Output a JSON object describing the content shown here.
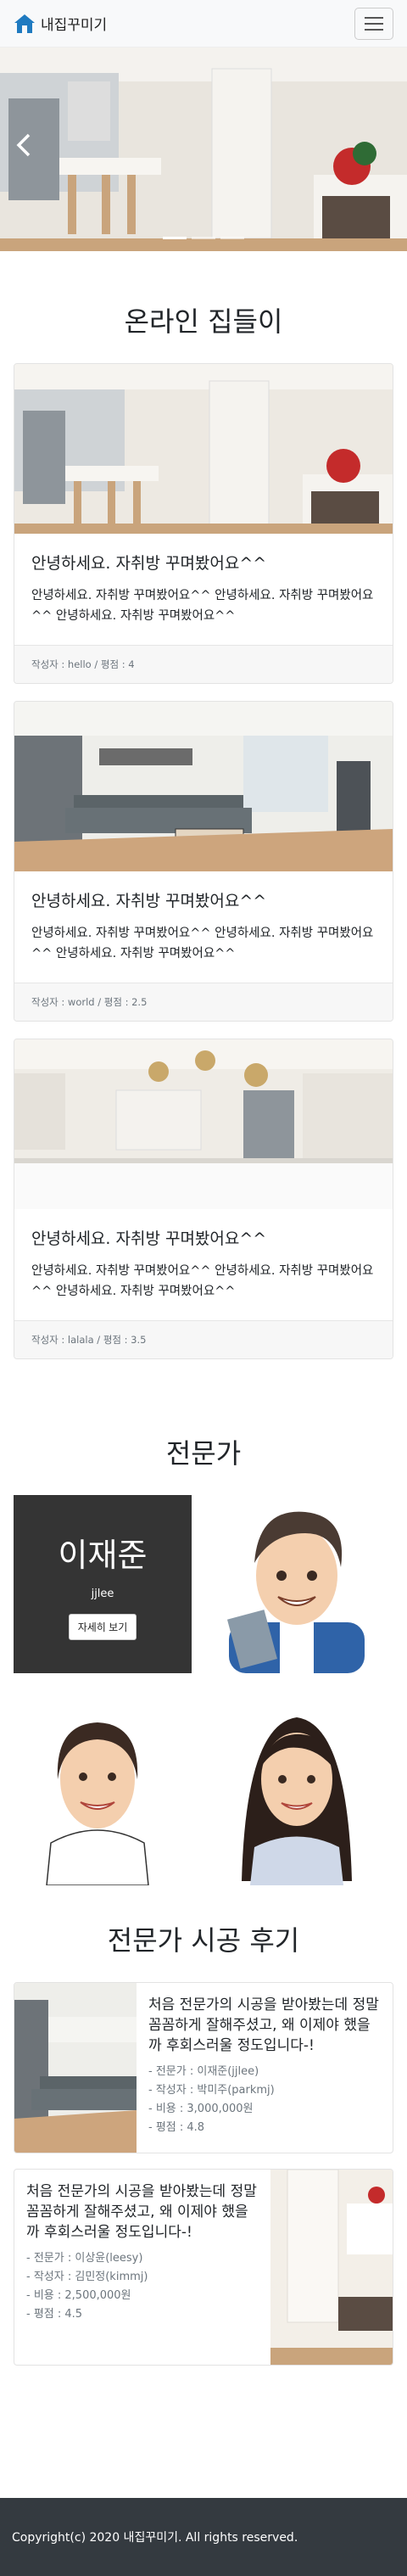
{
  "navbar": {
    "brand": "내집꾸미기"
  },
  "sections": {
    "online": "온라인 집들이",
    "experts": "전문가",
    "reviews": "전문가 시공 후기"
  },
  "cards": [
    {
      "title": "안녕하세요. 자취방 꾸며봤어요^^",
      "text": "안녕하세요. 자취방 꾸며봤어요^^ 안녕하세요. 자취방 꾸며봤어요^^ 안녕하세요. 자취방 꾸며봤어요^^",
      "footer": "작성자 : hello / 평점 : 4"
    },
    {
      "title": "안녕하세요. 자취방 꾸며봤어요^^",
      "text": "안녕하세요. 자취방 꾸며봤어요^^ 안녕하세요. 자취방 꾸며봤어요^^ 안녕하세요. 자취방 꾸며봤어요^^",
      "footer": "작성자 : world / 평점 : 2.5"
    },
    {
      "title": "안녕하세요. 자취방 꾸며봤어요^^",
      "text": "안녕하세요. 자취방 꾸며봤어요^^ 안녕하세요. 자취방 꾸며봤어요^^ 안녕하세요. 자취방 꾸며봤어요^^",
      "footer": "작성자 : lalala / 평점 : 3.5"
    }
  ],
  "expert": {
    "name": "이재준",
    "id": "jjlee",
    "button": "자세히 보기"
  },
  "reviews": [
    {
      "title": "처음 전문가의 시공을 받아봤는데 정말 꼼꼼하게 잘해주셨고, 왜 이제야 했을까 후회스러울 정도입니다-!",
      "items": [
        "전문가 : 이재준(jjlee)",
        "작성자 : 박미주(parkmj)",
        "비용 : 3,000,000원",
        "평점 : 4.8"
      ]
    },
    {
      "title": "처음 전문가의 시공을 받아봤는데 정말 꼼꼼하게 잘해주셨고, 왜 이제야 했을까 후회스러울 정도입니다-!",
      "items": [
        "전문가 : 이상윤(leesy)",
        "작성자 : 김민정(kimmj)",
        "비용 : 2,500,000원",
        "평점 : 4.5"
      ]
    }
  ],
  "footer": {
    "copyright": "Copyright(c) 2020 내집꾸미기. All rights reserved."
  },
  "colors": {
    "dark": "#343434",
    "footer_bg": "#343a40",
    "brand_icon": "#1f7ac0"
  },
  "icons": {
    "brand": "house-icon",
    "menu": "hamburger-icon",
    "prev": "chevron-left-icon"
  }
}
